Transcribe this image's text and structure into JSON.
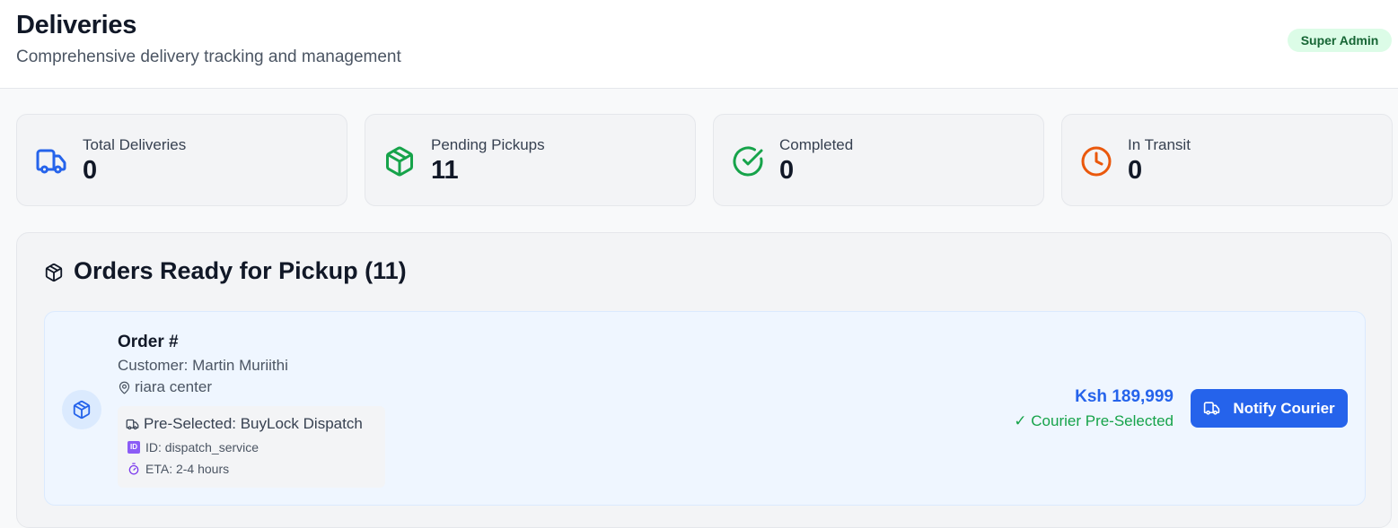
{
  "header": {
    "title": "Deliveries",
    "subtitle": "Comprehensive delivery tracking and management",
    "role_badge": "Super Admin"
  },
  "stats": [
    {
      "label": "Total Deliveries",
      "value": "0",
      "icon": "truck-icon",
      "color": "#2563eb"
    },
    {
      "label": "Pending Pickups",
      "value": "11",
      "icon": "package-icon",
      "color": "#16a34a"
    },
    {
      "label": "Completed",
      "value": "0",
      "icon": "check-circle-icon",
      "color": "#16a34a"
    },
    {
      "label": "In Transit",
      "value": "0",
      "icon": "clock-icon",
      "color": "#ea580c"
    }
  ],
  "pickup_section": {
    "title": "Orders Ready for Pickup (11)",
    "icon": "package-icon",
    "orders": [
      {
        "title": "Order #",
        "customer": "Customer: Martin Muriithi",
        "location": "riara center",
        "courier": "Pre-Selected: BuyLock Dispatch",
        "courier_id": "ID: dispatch_service",
        "eta": "ETA: 2-4 hours",
        "price": "Ksh 189,999",
        "status": "✓ Courier Pre-Selected",
        "action_label": "Notify Courier"
      }
    ]
  },
  "colors": {
    "accent": "#2563eb",
    "success": "#16a34a",
    "warning": "#ea580c"
  }
}
